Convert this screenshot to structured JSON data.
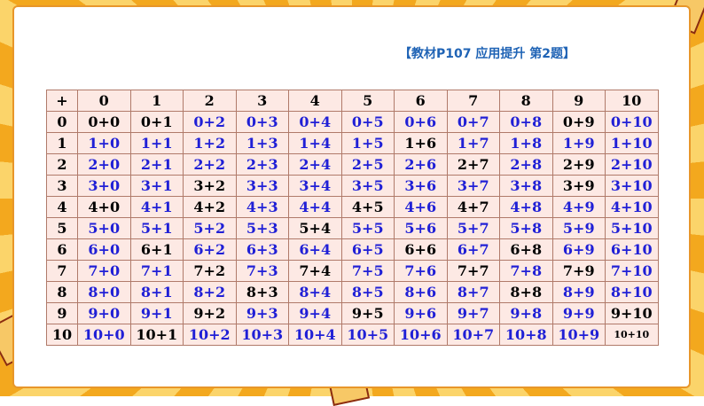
{
  "title": "【教材P107 应用提升 第2题】",
  "colors": {
    "blue": "#1f1fd6",
    "black": "#000000",
    "cell_bg": "#fde9e4"
  },
  "corner": "+",
  "col_headers": [
    "0",
    "1",
    "2",
    "3",
    "4",
    "5",
    "6",
    "7",
    "8",
    "9",
    "10"
  ],
  "rows": [
    {
      "head": "0",
      "cells": [
        {
          "t": "0+0",
          "c": "black"
        },
        {
          "t": "0+1",
          "c": "black"
        },
        {
          "t": "0+2",
          "c": "blue"
        },
        {
          "t": "0+3",
          "c": "blue"
        },
        {
          "t": "0+4",
          "c": "blue"
        },
        {
          "t": "0+5",
          "c": "blue"
        },
        {
          "t": "0+6",
          "c": "blue"
        },
        {
          "t": "0+7",
          "c": "blue"
        },
        {
          "t": "0+8",
          "c": "blue"
        },
        {
          "t": "0+9",
          "c": "black"
        },
        {
          "t": "0+10",
          "c": "blue"
        }
      ]
    },
    {
      "head": "1",
      "cells": [
        {
          "t": "1+0",
          "c": "blue"
        },
        {
          "t": "1+1",
          "c": "blue"
        },
        {
          "t": "1+2",
          "c": "blue"
        },
        {
          "t": "1+3",
          "c": "blue"
        },
        {
          "t": "1+4",
          "c": "blue"
        },
        {
          "t": "1+5",
          "c": "blue"
        },
        {
          "t": "1+6",
          "c": "black"
        },
        {
          "t": "1+7",
          "c": "blue"
        },
        {
          "t": "1+8",
          "c": "blue"
        },
        {
          "t": "1+9",
          "c": "blue"
        },
        {
          "t": "1+10",
          "c": "blue"
        }
      ]
    },
    {
      "head": "2",
      "cells": [
        {
          "t": "2+0",
          "c": "blue"
        },
        {
          "t": "2+1",
          "c": "blue"
        },
        {
          "t": "2+2",
          "c": "blue"
        },
        {
          "t": "2+3",
          "c": "blue"
        },
        {
          "t": "2+4",
          "c": "blue"
        },
        {
          "t": "2+5",
          "c": "blue"
        },
        {
          "t": "2+6",
          "c": "blue"
        },
        {
          "t": "2+7",
          "c": "black"
        },
        {
          "t": "2+8",
          "c": "blue"
        },
        {
          "t": "2+9",
          "c": "black"
        },
        {
          "t": "2+10",
          "c": "blue"
        }
      ]
    },
    {
      "head": "3",
      "cells": [
        {
          "t": "3+0",
          "c": "blue"
        },
        {
          "t": "3+1",
          "c": "blue"
        },
        {
          "t": "3+2",
          "c": "black"
        },
        {
          "t": "3+3",
          "c": "blue"
        },
        {
          "t": "3+4",
          "c": "blue"
        },
        {
          "t": "3+5",
          "c": "blue"
        },
        {
          "t": "3+6",
          "c": "blue"
        },
        {
          "t": "3+7",
          "c": "blue"
        },
        {
          "t": "3+8",
          "c": "blue"
        },
        {
          "t": "3+9",
          "c": "black"
        },
        {
          "t": "3+10",
          "c": "blue"
        }
      ]
    },
    {
      "head": "4",
      "cells": [
        {
          "t": "4+0",
          "c": "black"
        },
        {
          "t": "4+1",
          "c": "blue"
        },
        {
          "t": "4+2",
          "c": "black"
        },
        {
          "t": "4+3",
          "c": "blue"
        },
        {
          "t": "4+4",
          "c": "blue"
        },
        {
          "t": "4+5",
          "c": "black"
        },
        {
          "t": "4+6",
          "c": "blue"
        },
        {
          "t": "4+7",
          "c": "black"
        },
        {
          "t": "4+8",
          "c": "blue"
        },
        {
          "t": "4+9",
          "c": "blue"
        },
        {
          "t": "4+10",
          "c": "blue"
        }
      ]
    },
    {
      "head": "5",
      "cells": [
        {
          "t": "5+0",
          "c": "blue"
        },
        {
          "t": "5+1",
          "c": "blue"
        },
        {
          "t": "5+2",
          "c": "blue"
        },
        {
          "t": "5+3",
          "c": "blue"
        },
        {
          "t": "5+4",
          "c": "black"
        },
        {
          "t": "5+5",
          "c": "blue"
        },
        {
          "t": "5+6",
          "c": "blue"
        },
        {
          "t": "5+7",
          "c": "blue"
        },
        {
          "t": "5+8",
          "c": "blue"
        },
        {
          "t": "5+9",
          "c": "blue"
        },
        {
          "t": "5+10",
          "c": "blue"
        }
      ]
    },
    {
      "head": "6",
      "cells": [
        {
          "t": "6+0",
          "c": "blue"
        },
        {
          "t": "6+1",
          "c": "black"
        },
        {
          "t": "6+2",
          "c": "blue"
        },
        {
          "t": "6+3",
          "c": "blue"
        },
        {
          "t": "6+4",
          "c": "blue"
        },
        {
          "t": "6+5",
          "c": "blue"
        },
        {
          "t": "6+6",
          "c": "black"
        },
        {
          "t": "6+7",
          "c": "blue"
        },
        {
          "t": "6+8",
          "c": "black"
        },
        {
          "t": "6+9",
          "c": "blue"
        },
        {
          "t": "6+10",
          "c": "blue"
        }
      ]
    },
    {
      "head": "7",
      "cells": [
        {
          "t": "7+0",
          "c": "blue"
        },
        {
          "t": "7+1",
          "c": "blue"
        },
        {
          "t": "7+2",
          "c": "black"
        },
        {
          "t": "7+3",
          "c": "blue"
        },
        {
          "t": "7+4",
          "c": "black"
        },
        {
          "t": "7+5",
          "c": "blue"
        },
        {
          "t": "7+6",
          "c": "blue"
        },
        {
          "t": "7+7",
          "c": "black"
        },
        {
          "t": "7+8",
          "c": "blue"
        },
        {
          "t": "7+9",
          "c": "black"
        },
        {
          "t": "7+10",
          "c": "blue"
        }
      ]
    },
    {
      "head": "8",
      "cells": [
        {
          "t": "8+0",
          "c": "blue"
        },
        {
          "t": "8+1",
          "c": "blue"
        },
        {
          "t": "8+2",
          "c": "blue"
        },
        {
          "t": "8+3",
          "c": "black"
        },
        {
          "t": "8+4",
          "c": "blue"
        },
        {
          "t": "8+5",
          "c": "blue"
        },
        {
          "t": "8+6",
          "c": "blue"
        },
        {
          "t": "8+7",
          "c": "blue"
        },
        {
          "t": "8+8",
          "c": "black"
        },
        {
          "t": "8+9",
          "c": "blue"
        },
        {
          "t": "8+10",
          "c": "blue"
        }
      ]
    },
    {
      "head": "9",
      "cells": [
        {
          "t": "9+0",
          "c": "blue"
        },
        {
          "t": "9+1",
          "c": "blue"
        },
        {
          "t": "9+2",
          "c": "black"
        },
        {
          "t": "9+3",
          "c": "blue"
        },
        {
          "t": "9+4",
          "c": "blue"
        },
        {
          "t": "9+5",
          "c": "black"
        },
        {
          "t": "9+6",
          "c": "blue"
        },
        {
          "t": "9+7",
          "c": "blue"
        },
        {
          "t": "9+8",
          "c": "blue"
        },
        {
          "t": "9+9",
          "c": "blue"
        },
        {
          "t": "9+10",
          "c": "black"
        }
      ]
    },
    {
      "head": "10",
      "cells": [
        {
          "t": "10+0",
          "c": "blue"
        },
        {
          "t": "10+1",
          "c": "black"
        },
        {
          "t": "10+2",
          "c": "blue"
        },
        {
          "t": "10+3",
          "c": "blue"
        },
        {
          "t": "10+4",
          "c": "blue"
        },
        {
          "t": "10+5",
          "c": "blue"
        },
        {
          "t": "10+6",
          "c": "blue"
        },
        {
          "t": "10+7",
          "c": "blue"
        },
        {
          "t": "10+8",
          "c": "blue"
        },
        {
          "t": "10+9",
          "c": "blue"
        },
        {
          "t": "10+10",
          "c": "black",
          "small": true
        }
      ]
    }
  ]
}
